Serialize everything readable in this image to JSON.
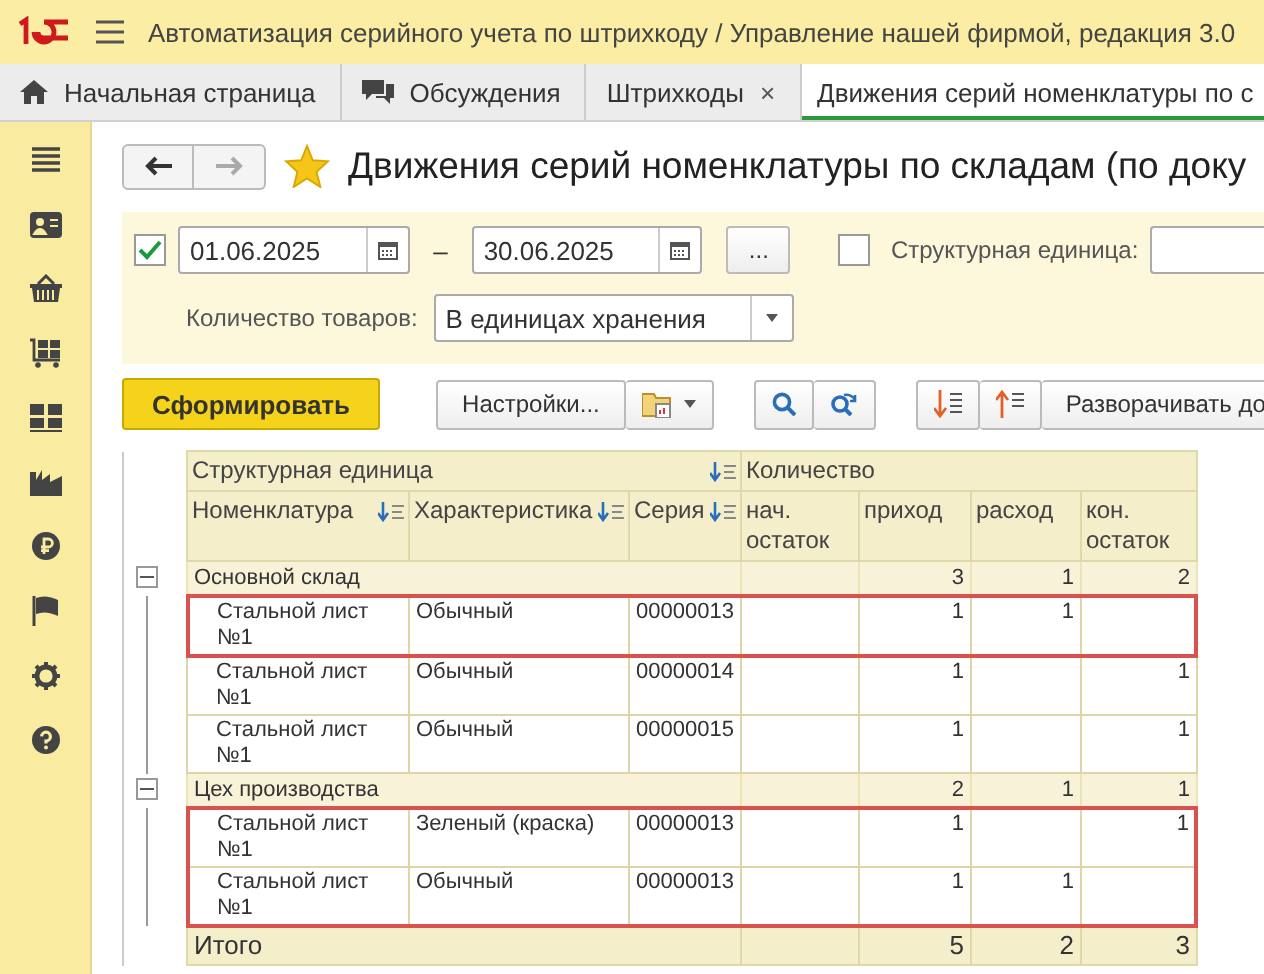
{
  "app_title": "Автоматизация серийного учета по штрихкоду / Управление нашей фирмой, редакция 3.0",
  "tabs": [
    {
      "label": "Начальная страница",
      "kind": "home",
      "selected": false
    },
    {
      "label": "Обсуждения",
      "kind": "chat",
      "selected": false
    },
    {
      "label": "Штрихкоды",
      "kind": "plain",
      "close": "×",
      "selected": false
    },
    {
      "label": "Движения серий номенклатуры по с",
      "kind": "plain",
      "selected": true
    }
  ],
  "nav": {
    "back_disabled": false,
    "forward_disabled": true
  },
  "report_title": "Движения серий номенклатуры по складам (по доку",
  "favorite": true,
  "filters": {
    "period_checked": true,
    "date_from": "01.06.2025",
    "dash": "–",
    "date_to": "30.06.2025",
    "period_button": "...",
    "unit_checked": false,
    "unit_label": "Структурная единица:",
    "quantity_label": "Количество товаров:",
    "quantity_value": "В единицах хранения"
  },
  "toolbar": {
    "generate": "Сформировать",
    "settings": "Настройки...",
    "expand": "Разворачивать до"
  },
  "table": {
    "group_heading": "Структурная единица",
    "quantity_heading": "Количество",
    "columns": [
      {
        "label": "Номенклатура",
        "sortable": true
      },
      {
        "label": "Характеристика",
        "sortable": true
      },
      {
        "label": "Серия",
        "sortable": true
      },
      {
        "label": "нач. остаток",
        "sortable": false
      },
      {
        "label": "приход",
        "sortable": false
      },
      {
        "label": "расход",
        "sortable": false
      },
      {
        "label": "кон. остаток",
        "sortable": false
      }
    ],
    "groups": [
      {
        "name": "Основной склад",
        "expanded": true,
        "income": "3",
        "expense": "1",
        "end": "2",
        "rows": [
          {
            "item": "Стальной лист №1",
            "characteristic": "Обычный",
            "series": "00000013",
            "income": "1",
            "expense": "1",
            "highlighted": true
          },
          {
            "item": "Стальной лист №1",
            "characteristic": "Обычный",
            "series": "00000014",
            "income": "1",
            "end": "1",
            "highlighted": false
          },
          {
            "item": "Стальной лист №1",
            "characteristic": "Обычный",
            "series": "00000015",
            "income": "1",
            "end": "1",
            "highlighted": false
          }
        ]
      },
      {
        "name": "Цех производства",
        "expanded": true,
        "income": "2",
        "expense": "1",
        "end": "1",
        "rows": [
          {
            "item": "Стальной лист №1",
            "characteristic": "Зеленый (краска)",
            "series": "00000013",
            "income": "1",
            "end": "1",
            "highlighted": true
          },
          {
            "item": "Стальной лист №1",
            "characteristic": "Обычный",
            "series": "00000013",
            "income": "1",
            "expense": "1",
            "highlighted": true
          }
        ]
      }
    ],
    "total": {
      "label": "Итого",
      "income": "5",
      "expense": "2",
      "end": "3"
    }
  }
}
